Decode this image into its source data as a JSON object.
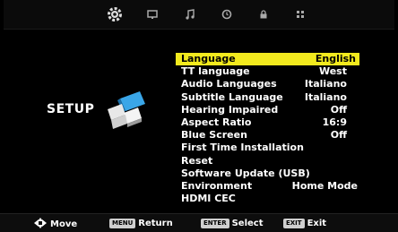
{
  "tabs": [
    {
      "icon": "gear-icon"
    },
    {
      "icon": "monitor-icon"
    },
    {
      "icon": "music-note-icon"
    },
    {
      "icon": "clock-icon"
    },
    {
      "icon": "lock-icon"
    },
    {
      "icon": "grid-icon"
    }
  ],
  "page": {
    "title": "SETUP"
  },
  "menu": {
    "selected_index": 0,
    "items": [
      {
        "label": "Language",
        "value": "English"
      },
      {
        "label": "TT language",
        "value": "West"
      },
      {
        "label": "Audio Languages",
        "value": "Italiano"
      },
      {
        "label": "Subtitle Language",
        "value": "Italiano"
      },
      {
        "label": "Hearing Impaired",
        "value": "Off"
      },
      {
        "label": "Aspect Ratio",
        "value": "16:9"
      },
      {
        "label": "Blue Screen",
        "value": "Off"
      },
      {
        "label": "First Time Installation",
        "value": ""
      },
      {
        "label": "Reset",
        "value": ""
      },
      {
        "label": "Software Update (USB)",
        "value": ""
      },
      {
        "label": "Environment",
        "value": "Home Mode"
      },
      {
        "label": "HDMI CEC",
        "value": ""
      }
    ]
  },
  "footer": {
    "move": {
      "label": "Move",
      "icon": "arrow-keys-icon"
    },
    "return": {
      "key": "MENU",
      "label": "Return"
    },
    "select": {
      "key": "ENTER",
      "label": "Select"
    },
    "exit": {
      "key": "EXIT",
      "label": "Exit"
    }
  },
  "colors": {
    "highlight": "#f2ea1e",
    "background": "#000000",
    "logo_blue": "#3aa6e8"
  }
}
